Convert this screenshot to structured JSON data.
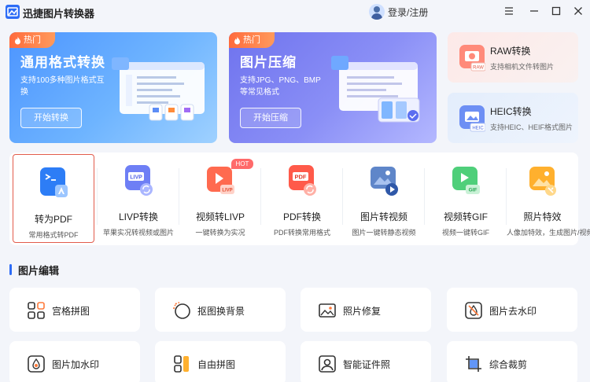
{
  "app": {
    "title": "迅捷图片转换器",
    "login_text": "登录/注册"
  },
  "hero": [
    {
      "tag": "热门",
      "title": "通用格式转换",
      "desc": "支持100多种图片格式互换",
      "button": "开始转换"
    },
    {
      "tag": "热门",
      "title": "图片压缩",
      "desc": "支持JPG、PNG、BMP等常见格式",
      "button": "开始压缩"
    }
  ],
  "side_cards": [
    {
      "title": "RAW转换",
      "desc": "支持相机文件转图片",
      "icon": "raw-icon"
    },
    {
      "title": "HEIC转换",
      "desc": "支持HEIC、HEIF格式图片",
      "icon": "heic-icon"
    }
  ],
  "tools": [
    {
      "name": "转为PDF",
      "desc": "常用格式转PDF",
      "icon": "pdf-convert-icon",
      "selected": true
    },
    {
      "name": "LIVP转换",
      "desc": "苹果实况转视频或图片",
      "icon": "livp-icon"
    },
    {
      "name": "视频转LIVP",
      "desc": "一键转换为实况",
      "icon": "video-to-livp-icon",
      "badge": "HOT"
    },
    {
      "name": "PDF转换",
      "desc": "PDF转换常用格式",
      "icon": "pdf-icon"
    },
    {
      "name": "图片转视频",
      "desc": "图片一键转静态视频",
      "icon": "image-to-video-icon"
    },
    {
      "name": "视频转GIF",
      "desc": "视频一键转GIF",
      "icon": "gif-icon"
    },
    {
      "name": "照片特效",
      "desc": "人像加特效，生成图片/视频",
      "icon": "photo-effect-icon"
    }
  ],
  "section": {
    "title": "图片编辑"
  },
  "edit_tools": [
    {
      "label": "宫格拼图",
      "icon": "grid-icon"
    },
    {
      "label": "抠图换背景",
      "icon": "cutout-icon"
    },
    {
      "label": "照片修复",
      "icon": "photo-repair-icon"
    },
    {
      "label": "图片去水印",
      "icon": "remove-watermark-icon"
    },
    {
      "label": "图片加水印",
      "icon": "add-watermark-icon"
    },
    {
      "label": "自由拼图",
      "icon": "free-collage-icon"
    },
    {
      "label": "智能证件照",
      "icon": "id-photo-icon"
    },
    {
      "label": "综合裁剪",
      "icon": "crop-icon"
    }
  ],
  "colors": {
    "accent": "#2d6cf6",
    "hot": "#ff6b3d",
    "selected_border": "#e25b4b"
  }
}
